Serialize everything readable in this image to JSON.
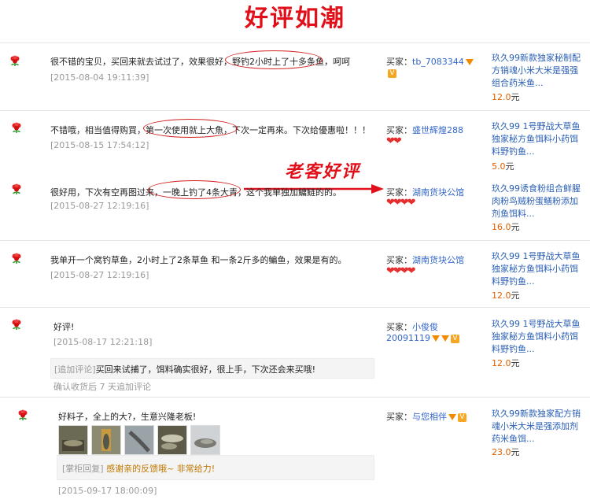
{
  "banner": {
    "title": "好评如潮"
  },
  "annotation": {
    "label": "老客好评"
  },
  "reviews": [
    {
      "comment": "很不错的宝贝，买回来就去试过了，效果很好，野钓2小时上了十多条鱼，呵呵",
      "date": "[2015-08-04 19:11:39]",
      "buyer_prefix": "买家：",
      "buyer_name": "tb_7083344",
      "product": "玖久99新款独家秘制配方销魂小米大米是强强组合药米鱼...",
      "price": "12.0",
      "unit": "元"
    },
    {
      "comment": "不错哦，相当值得购買，第一次使用就上大魚，下次一定再來。下次给優惠啦！！！",
      "date": "[2015-08-15 17:54:12]",
      "buyer_prefix": "买家：",
      "buyer_name": "盛世辉煌288",
      "product": "玖久99 1号野战大草鱼独家秘方鱼饵料小药饵料野钓鱼...",
      "price": "5.0",
      "unit": "元"
    },
    {
      "comment": "很好用，下次有空再图过来，一晚上钓了4条大青，这个我单独加鳙鲢的的。",
      "date": "[2015-08-27 12:19:16]",
      "buyer_prefix": "买家：",
      "buyer_name": "湖南货块公馆",
      "product": "玖久99诱食粉组合鲜腥肉粉鸟贼粉蛋鳝粉添加剂鱼饵料...",
      "price": "16.0",
      "unit": "元"
    },
    {
      "comment": "我单开一个窝钓草鱼，2小时上了2条草鱼 和一条2斤多的鳊鱼，效果是有的。",
      "date": "[2015-08-27 12:19:16]",
      "buyer_prefix": "买家：",
      "buyer_name": "湖南货块公馆",
      "product": "玖久99 1号野战大草鱼独家秘方鱼饵料小药饵料野钓鱼...",
      "price": "12.0",
      "unit": "元"
    },
    {
      "comment": "好评!",
      "date": "[2015-08-17 12:21:18]",
      "followup_tag": "[追加评论]",
      "followup_text": "买回来试捕了，饵料确实很好，很上手，下次还会来买哦!",
      "followup_note": "确认收货后 7 天追加评论",
      "buyer_prefix": "买家：",
      "buyer_name": "小俊俊",
      "buyer_name2": "20091119",
      "product": "玖久99 1号野战大草鱼独家秘方鱼饵料小药饵料野钓鱼...",
      "price": "12.0",
      "unit": "元"
    },
    {
      "comment": "好料子，全上的大?，生意兴隆老板!",
      "reply_tag": "[掌柜回复]",
      "reply_text": "感谢亲的反馈哦~ 非常给力!",
      "date": "[2015-09-17 18:00:09]",
      "buyer_prefix": "买家：",
      "buyer_name": "与您相伴",
      "product": "玖久99新款独家配方销魂小米大米是强添加剂药米鱼饵...",
      "price": "23.0",
      "unit": "元"
    }
  ],
  "colors": {
    "accent": "#e0101a",
    "link": "#2a5fb5",
    "price": "#e06000",
    "muted": "#999999"
  }
}
